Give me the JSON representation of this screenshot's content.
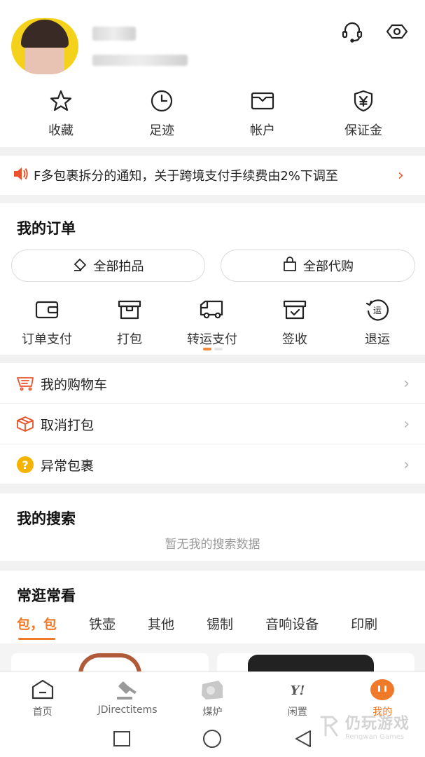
{
  "quick": [
    {
      "label": "收藏",
      "icon": "star-icon"
    },
    {
      "label": "足迹",
      "icon": "clock-icon"
    },
    {
      "label": "帐户",
      "icon": "wallet-icon"
    },
    {
      "label": "保证金",
      "icon": "shield-yen-icon"
    }
  ],
  "notice": {
    "text": "F多包裹拆分的通知，关于跨境支付手续费由2%下调至",
    "arrow": "›"
  },
  "orders": {
    "title": "我的订单",
    "auction_btn": "全部拍品",
    "proxy_btn": "全部代购",
    "items": [
      {
        "label": "订单支付",
        "icon": "wallet-card-icon"
      },
      {
        "label": "打包",
        "icon": "package-box-icon"
      },
      {
        "label": "转运支付",
        "icon": "delivery-truck-icon"
      },
      {
        "label": "签收",
        "icon": "sign-box-icon"
      },
      {
        "label": "退运",
        "icon": "return-icon"
      }
    ],
    "return_glyph": "运"
  },
  "list": [
    {
      "label": "我的购物车",
      "icon": "cart-icon"
    },
    {
      "label": "取消打包",
      "icon": "box-cancel-icon"
    },
    {
      "label": "异常包裹",
      "icon": "question-icon"
    }
  ],
  "list_arrow": "›",
  "question_glyph": "?",
  "search": {
    "title": "我的搜索",
    "empty": "暂无我的搜索数据"
  },
  "browse": {
    "title": "常逛常看",
    "categories": [
      "包，包",
      "铁壶",
      "其他",
      "锡制",
      "音响设备",
      "印刷"
    ]
  },
  "tabs": [
    {
      "label": "首页",
      "icon": "home-icon"
    },
    {
      "label": "JDirectitems",
      "icon": "gavel-icon"
    },
    {
      "label": "煤炉",
      "icon": "mercari-icon"
    },
    {
      "label": "闲置",
      "icon": "yahoo-icon"
    },
    {
      "label": "我的",
      "icon": "mine-icon"
    }
  ],
  "yahoo_logo": "Y!",
  "watermark": {
    "main": "仍玩游戏",
    "sub": "Rengwan Games"
  },
  "colors": {
    "accent": "#f07a2a",
    "notice_red": "#e8532b",
    "avatar_bg": "#f4d21b",
    "question_yellow": "#f5b400"
  }
}
